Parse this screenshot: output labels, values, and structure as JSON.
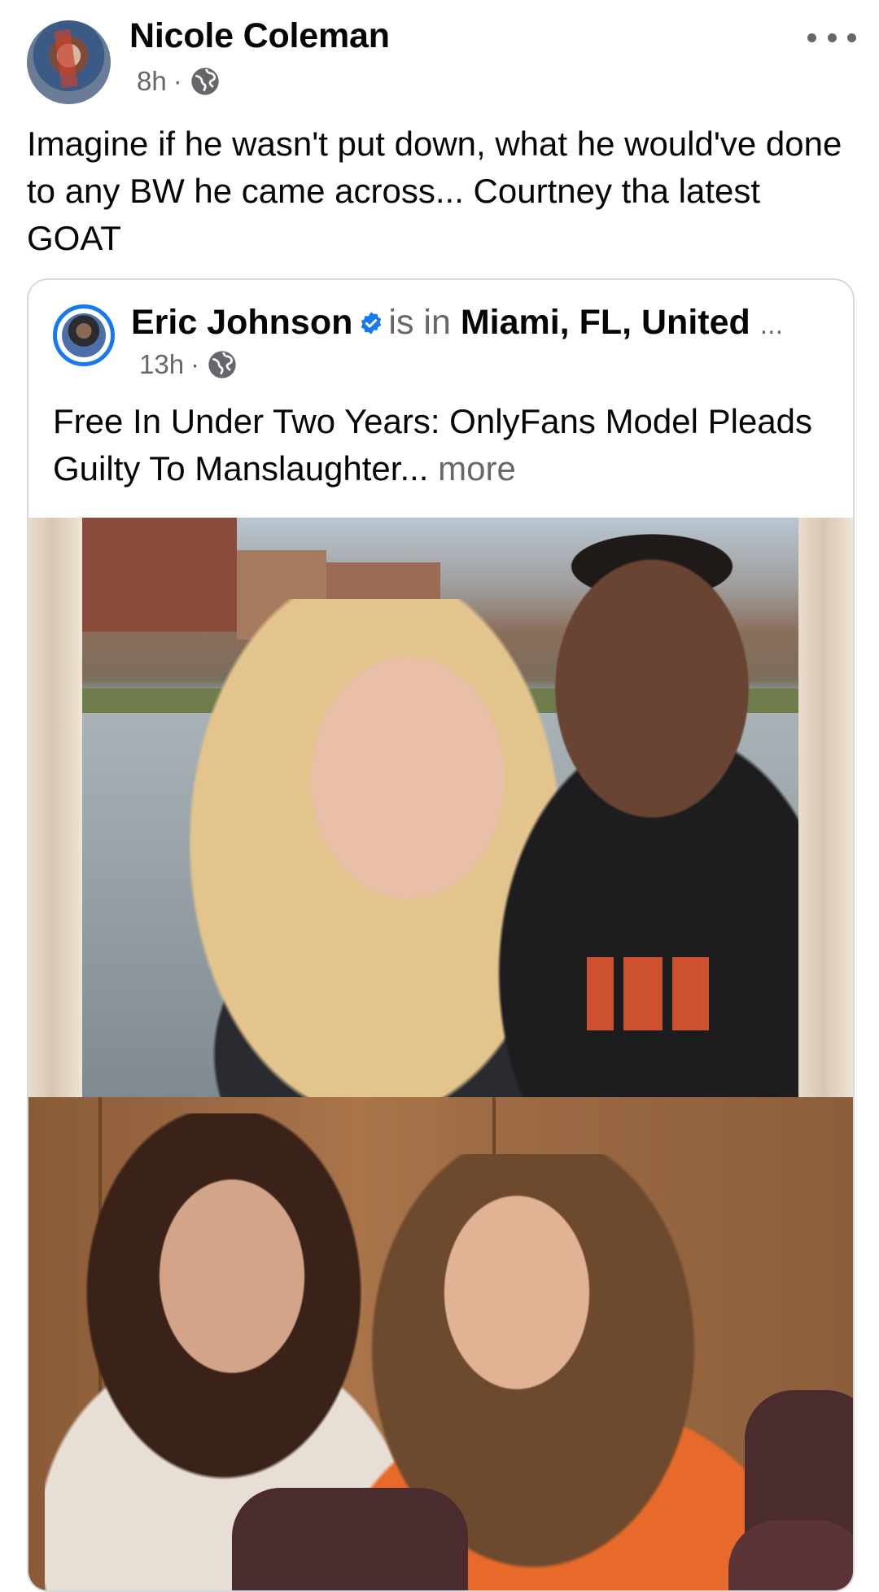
{
  "post": {
    "author": "Nicole Coleman",
    "time": "8h",
    "separator": "·",
    "privacy_icon": "globe-icon",
    "menu_icon": "more-horizontal-icon",
    "text": "Imagine if he wasn't put down, what he would've done to any BW he came across... Courtney tha latest GOAT"
  },
  "shared": {
    "author": "Eric Johnson",
    "verified_icon": "verified-badge-icon",
    "is_in": "is in",
    "location": "Miami, FL, United",
    "ellipsis": "...",
    "time": "13h",
    "separator": "·",
    "privacy_icon": "globe-icon",
    "text": "Free In Under Two Years: OnlyFans Model Pleads Guilty To Manslaughter...",
    "more": "more"
  },
  "colors": {
    "verified": "#1877f2",
    "muted": "#65676b",
    "text": "#050505",
    "card_border": "#d6d9de"
  }
}
